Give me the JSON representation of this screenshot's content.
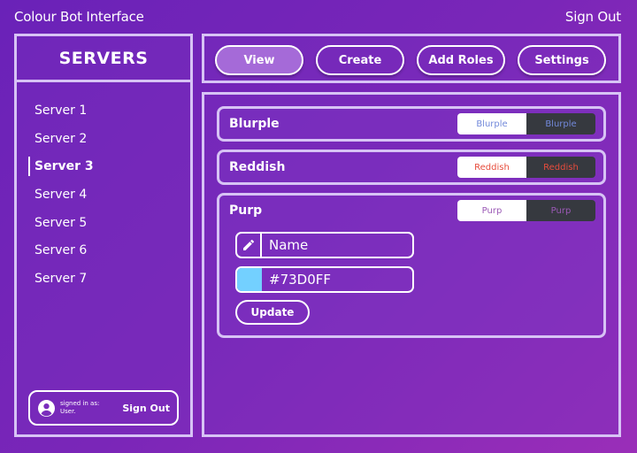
{
  "app": {
    "title": "Colour Bot Interface",
    "sign_out": "Sign Out"
  },
  "sidebar": {
    "title": "SERVERS",
    "items": [
      {
        "label": "Server 1",
        "active": false
      },
      {
        "label": "Server 2",
        "active": false
      },
      {
        "label": "Server 3",
        "active": true
      },
      {
        "label": "Server 4",
        "active": false
      },
      {
        "label": "Server 5",
        "active": false
      },
      {
        "label": "Server 6",
        "active": false
      },
      {
        "label": "Server 7",
        "active": false
      }
    ],
    "user": {
      "signed_in_label": "signed in as:",
      "user_name": "User.",
      "sign_out": "Sign Out"
    }
  },
  "nav": {
    "tabs": [
      {
        "label": "View",
        "active": true
      },
      {
        "label": "Create",
        "active": false
      },
      {
        "label": "Add Roles",
        "active": false
      },
      {
        "label": "Settings",
        "active": false
      }
    ]
  },
  "roles": [
    {
      "name": "Blurple",
      "preview_text": "Blurple",
      "color": "#7289da"
    },
    {
      "name": "Reddish",
      "preview_text": "Reddish",
      "color": "#e74c3c"
    },
    {
      "name": "Purp",
      "preview_text": "Purp",
      "color": "#9b59b6"
    }
  ],
  "edit_form": {
    "name_placeholder": "Name",
    "color_value": "#73D0FF",
    "swatch_color": "#73d0ff",
    "update_label": "Update"
  },
  "colors": {
    "panel_border": "#d7c3f5",
    "active_tab": "#a56ad8",
    "preview_dark": "#36393f",
    "preview_light": "#ffffff"
  },
  "icons": {
    "avatar": "account-circle-icon",
    "edit": "pencil-icon"
  }
}
